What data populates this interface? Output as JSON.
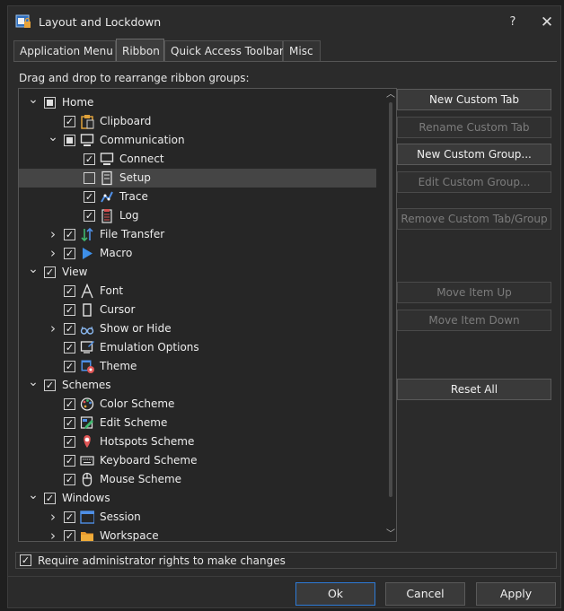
{
  "window": {
    "title": "Layout and Lockdown",
    "help_label": "?",
    "close_label": "✕"
  },
  "tabs": [
    "Application Menu",
    "Ribbon",
    "Quick Access Toolbar",
    "Misc"
  ],
  "description": "Drag and drop to rearrange ribbon groups:",
  "tree": [
    {
      "label": "Home",
      "level": 0,
      "expand": "down",
      "check": "partial",
      "icon": ""
    },
    {
      "label": "Clipboard",
      "level": 1,
      "expand": "",
      "check": "checked",
      "icon": "clipboard-icon"
    },
    {
      "label": "Communication",
      "level": 1,
      "expand": "down",
      "check": "partial",
      "icon": "monitor-icon"
    },
    {
      "label": "Connect",
      "level": 2,
      "expand": "",
      "check": "checked",
      "icon": "monitor-icon"
    },
    {
      "label": "Setup",
      "level": 2,
      "expand": "",
      "check": "unchecked",
      "icon": "setup-icon",
      "selected": true
    },
    {
      "label": "Trace",
      "level": 2,
      "expand": "",
      "check": "checked",
      "icon": "trace-icon"
    },
    {
      "label": "Log",
      "level": 2,
      "expand": "",
      "check": "checked",
      "icon": "log-icon"
    },
    {
      "label": "File Transfer",
      "level": 1,
      "expand": "right",
      "check": "checked",
      "icon": "transfer-icon"
    },
    {
      "label": "Macro",
      "level": 1,
      "expand": "right",
      "check": "checked",
      "icon": "play-icon"
    },
    {
      "label": "View",
      "level": 0,
      "expand": "down",
      "check": "checked",
      "icon": ""
    },
    {
      "label": "Font",
      "level": 1,
      "expand": "",
      "check": "checked",
      "icon": "font-icon"
    },
    {
      "label": "Cursor",
      "level": 1,
      "expand": "",
      "check": "checked",
      "icon": "cursor-icon"
    },
    {
      "label": "Show or Hide",
      "level": 1,
      "expand": "right",
      "check": "checked",
      "icon": "glasses-icon"
    },
    {
      "label": "Emulation Options",
      "level": 1,
      "expand": "",
      "check": "checked",
      "icon": "emulation-icon"
    },
    {
      "label": "Theme",
      "level": 1,
      "expand": "",
      "check": "checked",
      "icon": "theme-icon"
    },
    {
      "label": "Schemes",
      "level": 0,
      "expand": "down",
      "check": "checked",
      "icon": ""
    },
    {
      "label": "Color Scheme",
      "level": 1,
      "expand": "",
      "check": "checked",
      "icon": "palette-icon"
    },
    {
      "label": "Edit Scheme",
      "level": 1,
      "expand": "",
      "check": "checked",
      "icon": "edit-scheme-icon"
    },
    {
      "label": "Hotspots Scheme",
      "level": 1,
      "expand": "",
      "check": "checked",
      "icon": "hotspot-icon"
    },
    {
      "label": "Keyboard Scheme",
      "level": 1,
      "expand": "",
      "check": "checked",
      "icon": "keyboard-icon"
    },
    {
      "label": "Mouse Scheme",
      "level": 1,
      "expand": "",
      "check": "checked",
      "icon": "mouse-icon"
    },
    {
      "label": "Windows",
      "level": 0,
      "expand": "down",
      "check": "checked",
      "icon": ""
    },
    {
      "label": "Session",
      "level": 1,
      "expand": "right",
      "check": "checked",
      "icon": "session-icon"
    },
    {
      "label": "Workspace",
      "level": 1,
      "expand": "right",
      "check": "checked",
      "icon": "folder-icon"
    }
  ],
  "buttons": [
    {
      "label": "New Custom Tab",
      "enabled": true
    },
    {
      "label": "Rename Custom Tab",
      "enabled": false
    },
    {
      "label": "New Custom Group...",
      "enabled": true
    },
    {
      "label": "Edit Custom Group...",
      "enabled": false
    },
    {
      "label": "Remove Custom Tab/Group",
      "enabled": false
    },
    {
      "label": "Move Item Up",
      "enabled": false
    },
    {
      "label": "Move Item Down",
      "enabled": false
    },
    {
      "label": "Reset All",
      "enabled": true
    }
  ],
  "require_admin": {
    "label": "Require administrator rights to make changes",
    "checked": true
  },
  "footer": {
    "ok": "Ok",
    "cancel": "Cancel",
    "apply": "Apply"
  },
  "colors": {
    "accent": "#2d7ad6",
    "background": "#2b2b2b"
  }
}
